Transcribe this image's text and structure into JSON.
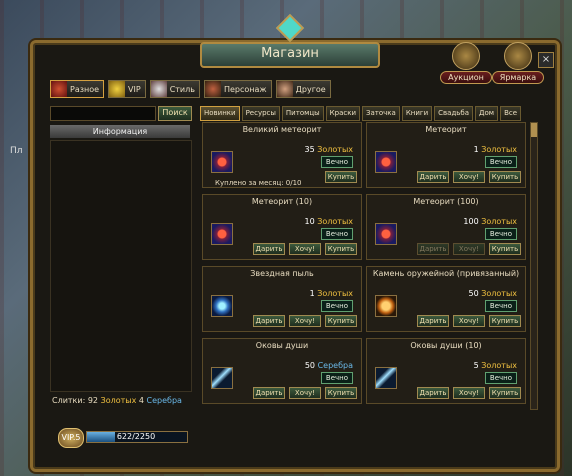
{
  "window": {
    "title": "Магазин",
    "close_label": "×"
  },
  "background": {
    "partial_label": "Пл"
  },
  "corner_buttons": [
    {
      "label": "Аукцион",
      "icon": "auction-icon"
    },
    {
      "label": "Ярмарка",
      "icon": "fair-icon"
    }
  ],
  "categories": [
    {
      "label": "Разное",
      "icon": "misc-icon"
    },
    {
      "label": "VIP",
      "icon": "crown-icon"
    },
    {
      "label": "Стиль",
      "icon": "style-icon"
    },
    {
      "label": "Персонаж",
      "icon": "character-icon"
    },
    {
      "label": "Другое",
      "icon": "other-icon"
    }
  ],
  "search": {
    "value": "",
    "button_label": "Поиск"
  },
  "info": {
    "header": "Информация"
  },
  "balance": {
    "prefix": "Слитки:",
    "gold_amount": "92",
    "gold_label": "Золотых",
    "silver_amount": "4",
    "silver_label": "Серебра"
  },
  "vip": {
    "level_label": "VIP.5",
    "progress_text": "622/2250",
    "progress_fraction": 0.276
  },
  "shop_tabs": [
    "Новинки",
    "Ресурсы",
    "Питомцы",
    "Краски",
    "Заточка",
    "Книги",
    "Свадьба",
    "Дом",
    "Все"
  ],
  "items": [
    {
      "title": "Великий метеорит",
      "price": "35",
      "currency": "Золотых",
      "duration": "Вечно",
      "icon": "meteor-icon",
      "buttons": [
        "Купить"
      ],
      "bought_label": "Куплено за месяц: 0/10"
    },
    {
      "title": "Метеорит",
      "price": "1",
      "currency": "Золотых",
      "duration": "Вечно",
      "icon": "meteor-icon",
      "buttons": [
        "Дарить",
        "Хочу!",
        "Купить"
      ]
    },
    {
      "title": "Метеорит (10)",
      "price": "10",
      "currency": "Золотых",
      "duration": "Вечно",
      "icon": "meteor-icon",
      "buttons": [
        "Дарить",
        "Хочу!",
        "Купить"
      ]
    },
    {
      "title": "Метеорит (100)",
      "price": "100",
      "currency": "Золотых",
      "duration": "Вечно",
      "icon": "meteor-icon",
      "buttons": [
        "Дарить",
        "Хочу!",
        "Купить"
      ]
    },
    {
      "title": "Звездная пыль",
      "price": "1",
      "currency": "Золотых",
      "duration": "Вечно",
      "icon": "dust-icon",
      "buttons": [
        "Дарить",
        "Хочу!",
        "Купить"
      ]
    },
    {
      "title": "Камень оружейной (привязанный)",
      "price": "50",
      "currency": "Золотых",
      "duration": "Вечно",
      "icon": "stone-icon",
      "buttons": [
        "Дарить",
        "Хочу!",
        "Купить"
      ]
    },
    {
      "title": "Оковы души",
      "price": "50",
      "currency": "Серебра",
      "duration": "Вечно",
      "icon": "shackle-icon",
      "buttons": [
        "Дарить",
        "Хочу!",
        "Купить"
      ]
    },
    {
      "title": "Оковы души (10)",
      "price": "5",
      "currency": "Золотых",
      "duration": "Вечно",
      "icon": "shackle-icon",
      "buttons": [
        "Дарить",
        "Хочу!",
        "Купить"
      ]
    }
  ]
}
